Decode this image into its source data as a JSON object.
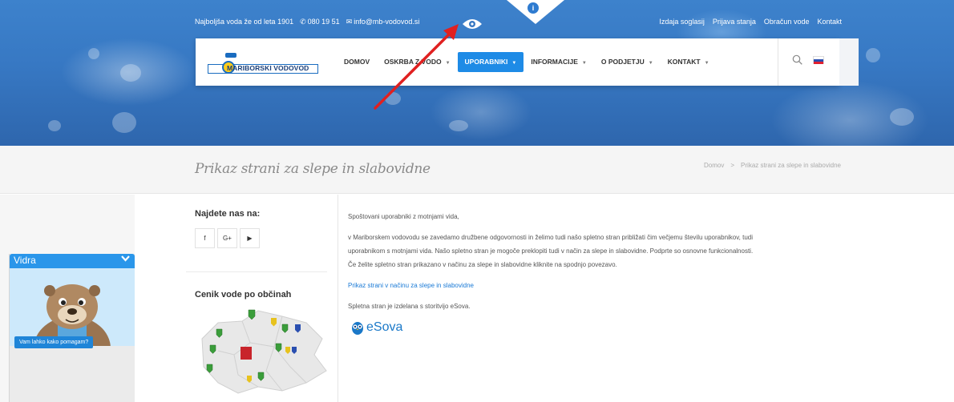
{
  "topbar": {
    "tagline": "Najboljša voda že od leta 1901",
    "phone_icon": "phone-icon",
    "phone": "080 19 51",
    "mail_icon": "mail-icon",
    "email": "info@mb-vodovod.si",
    "links": [
      "Izdaja soglasij",
      "Prijava stanja",
      "Obračun vode",
      "Kontakt"
    ]
  },
  "accessibility": {
    "icon": "eye-icon",
    "info_icon": "info-icon",
    "info_symbol": "i"
  },
  "logo": {
    "text": "MARIBORSKI VODOVOD"
  },
  "nav": {
    "items": [
      {
        "label": "DOMOV",
        "caret": ""
      },
      {
        "label": "OSKRBA Z VODO",
        "caret": "▼"
      },
      {
        "label": "UPORABNIKI",
        "caret": "▼"
      },
      {
        "label": "INFORMACIJE",
        "caret": "▼"
      },
      {
        "label": "O PODJETJU",
        "caret": "▼"
      },
      {
        "label": "KONTAKT",
        "caret": "▼"
      }
    ],
    "active": "UPORABNIKI"
  },
  "page": {
    "title": "Prikaz strani za slepe in slabovidne",
    "breadcrumb": [
      "Domov",
      ">",
      "Prikaz strani za slepe in slabovidne"
    ]
  },
  "widget": {
    "title": "Vidra",
    "chevron": "✔",
    "bubble": "Vam lahko kako pomagam?"
  },
  "sidebar": {
    "find_heading": "Najdete nas na:",
    "social": [
      {
        "name": "facebook-icon",
        "glyph": "f"
      },
      {
        "name": "google-plus-icon",
        "glyph": "G+"
      },
      {
        "name": "youtube-icon",
        "glyph": "▶"
      }
    ],
    "price_heading": "Cenik vode po občinah"
  },
  "content": {
    "greeting": "Spoštovani uporabniki z motnjami vida,",
    "para1_line1": "v Mariborskem vodovodu se zavedamo družbene odgovornosti in želimo tudi našo spletno stran približati čim večjemu številu uporabnikov,  tudi",
    "para1_line2": "uporabnikom s motnjami vida. Našo spletno stran je mogoče preklopiti tudi v način za slepe in slabovidne. Podprte so osnovne funkcionalnosti.",
    "para1_line3": "Če želite spletno stran prikazano v načinu za slepe in slabovidne kliknite na spodnjo povezavo.",
    "link": "Prikaz strani v  načinu za slepe in slabovidne",
    "made_with": "Spletna stran je izdelana s storitvijo eSova.",
    "brand": "eSova"
  },
  "colors": {
    "accent": "#1e8be6",
    "hero": "#3778c3",
    "annotation_arrow": "#e02020"
  }
}
